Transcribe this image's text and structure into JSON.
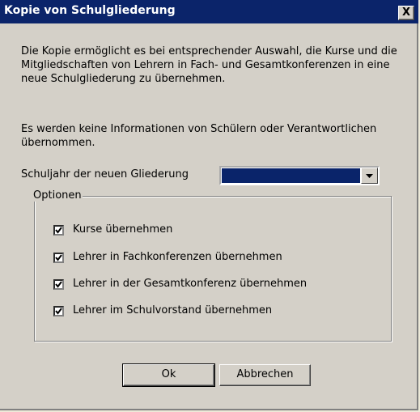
{
  "window": {
    "title": "Kopie von Schulgliederung",
    "close_label": "X"
  },
  "description": {
    "paragraph1": "Die Kopie ermöglicht es bei entsprechender Auswahl, die Kurse und die Mitgliedschaften von Lehrern in Fach- und Gesamtkonferenzen in eine neue Schulgliederung zu übernehmen.",
    "paragraph2": "Es werden keine Informationen von Schülern oder Verantwortlichen übernommen."
  },
  "year": {
    "label": "Schuljahr der neuen Gliederung",
    "value": ""
  },
  "options": {
    "legend": "Optionen",
    "items": [
      {
        "label": "Kurse übernehmen",
        "checked": true
      },
      {
        "label": "Lehrer in Fachkonferenzen übernehmen",
        "checked": true
      },
      {
        "label": "Lehrer in der Gesamtkonferenz übernehmen",
        "checked": true
      },
      {
        "label": "Lehrer im Schulvorstand übernehmen",
        "checked": true
      }
    ]
  },
  "buttons": {
    "ok": "Ok",
    "cancel": "Abbrechen"
  },
  "colors": {
    "titlebar": "#0b246a",
    "dialog_bg": "#d4d0c8",
    "selection": "#0a246a"
  }
}
